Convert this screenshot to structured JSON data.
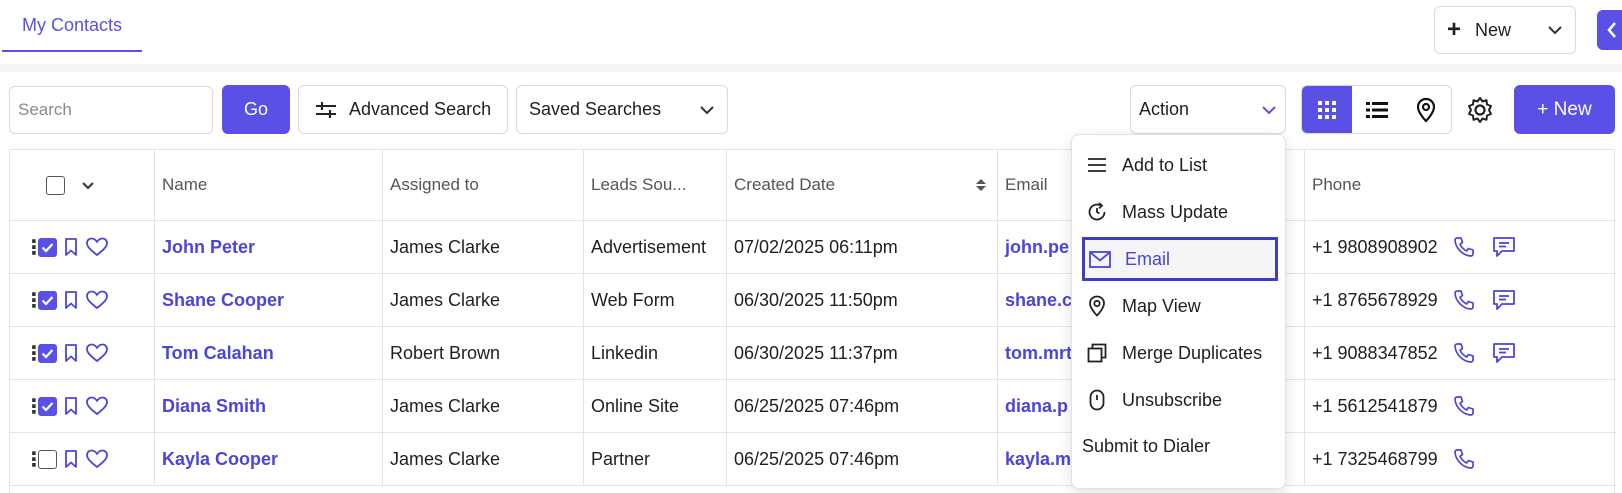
{
  "tabs": {
    "my_contacts": "My Contacts"
  },
  "header": {
    "new_dropdown_label": "New"
  },
  "toolbar": {
    "search_placeholder": "Search",
    "go_label": "Go",
    "advanced_search_label": "Advanced Search",
    "saved_searches_label": "Saved Searches",
    "action_label": "Action",
    "new_button_label": "+ New"
  },
  "table": {
    "columns": [
      "Name",
      "Assigned to",
      "Leads Sou...",
      "Created Date",
      "Email",
      "Phone"
    ],
    "rows": [
      {
        "checked": true,
        "name": "John Peter",
        "assigned": "James Clarke",
        "source": "Advertisement",
        "created": "07/02/2025 06:11pm",
        "email": "john.pe",
        "phone": "+1 9808908902",
        "sms": true
      },
      {
        "checked": true,
        "name": "Shane Cooper",
        "assigned": "James Clarke",
        "source": "Web Form",
        "created": "06/30/2025 11:50pm",
        "email": "shane.c",
        "phone": "+1 8765678929",
        "sms": true
      },
      {
        "checked": true,
        "name": "Tom Calahan",
        "assigned": "Robert Brown",
        "source": "Linkedin",
        "created": "06/30/2025 11:37pm",
        "email": "tom.mrt",
        "phone": "+1 9088347852",
        "sms": true
      },
      {
        "checked": true,
        "name": "Diana Smith",
        "assigned": "James Clarke",
        "source": "Online Site",
        "created": "06/25/2025 07:46pm",
        "email": "diana.p",
        "phone": "+1 5612541879",
        "sms": false
      },
      {
        "checked": false,
        "name": "Kayla Cooper",
        "assigned": "James Clarke",
        "source": "Partner",
        "created": "06/25/2025 07:46pm",
        "email": "kayla.m",
        "phone": "+1 7325468799",
        "sms": false
      }
    ]
  },
  "action_menu": {
    "highlighted": "Email",
    "items": [
      {
        "label": "Add to List",
        "icon": "list-icon"
      },
      {
        "label": "Mass Update",
        "icon": "refresh-icon"
      },
      {
        "label": "Email",
        "icon": "mail-icon"
      },
      {
        "label": "Map View",
        "icon": "map-pin-icon"
      },
      {
        "label": "Merge Duplicates",
        "icon": "copy-icon"
      },
      {
        "label": "Unsubscribe",
        "icon": "unsubscribe-icon"
      },
      {
        "label": "Submit to Dialer",
        "icon": ""
      }
    ]
  },
  "colors": {
    "accent": "#5b50e6",
    "link": "#4b46d6",
    "highlight_border": "#3c3fc4"
  }
}
